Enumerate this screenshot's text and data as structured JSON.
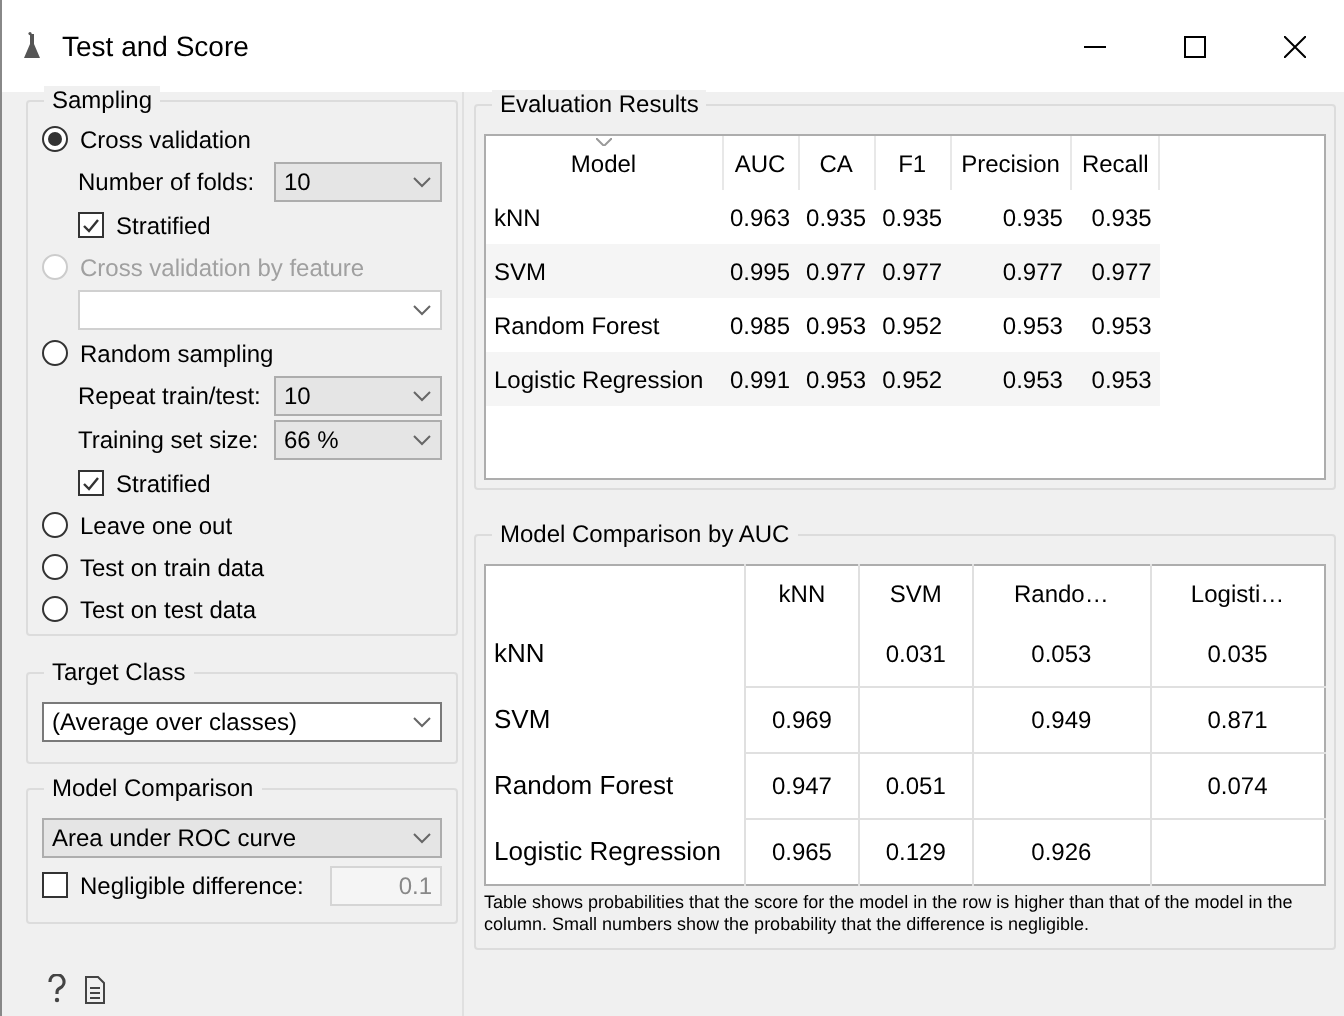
{
  "window": {
    "title": "Test and Score"
  },
  "sampling": {
    "title": "Sampling",
    "items": [
      {
        "kind": "radio",
        "label": "Cross validation",
        "selected": true,
        "disabled": false
      },
      {
        "kind": "combo",
        "label": "Number of folds:",
        "value": "10",
        "disabled": false
      },
      {
        "kind": "check",
        "label": "Stratified",
        "checked": true
      },
      {
        "kind": "radio",
        "label": "Cross validation by feature",
        "selected": false,
        "disabled": true
      },
      {
        "kind": "combo",
        "disabled": true
      },
      {
        "kind": "radio",
        "label": "Random sampling",
        "selected": false,
        "disabled": false
      },
      {
        "kind": "combo",
        "label": "Repeat train/test:",
        "value": "10",
        "disabled": false
      },
      {
        "kind": "combo",
        "label": "Training set size:",
        "value": "66 %",
        "disabled": false
      },
      {
        "kind": "check",
        "label": "Stratified",
        "checked": true
      },
      {
        "kind": "radio",
        "label": "Leave one out",
        "selected": false,
        "disabled": false
      },
      {
        "kind": "radio",
        "label": "Test on train data",
        "selected": false,
        "disabled": false
      },
      {
        "kind": "radio",
        "label": "Test on test data",
        "selected": false,
        "disabled": false
      }
    ]
  },
  "target_class": {
    "title": "Target Class",
    "value": "(Average over classes)"
  },
  "model_comparison": {
    "title": "Model Comparison",
    "value": "Area under ROC curve",
    "negligible": {
      "label": "Negligible difference:",
      "checked": false,
      "value": "0.1"
    }
  },
  "evaluation_results": {
    "title": "Evaluation Results",
    "columns": [
      "Model",
      "AUC",
      "CA",
      "F1",
      "Precision",
      "Recall"
    ],
    "rows": [
      [
        "kNN",
        "0.963",
        "0.935",
        "0.935",
        "0.935",
        "0.935"
      ],
      [
        "SVM",
        "0.995",
        "0.977",
        "0.977",
        "0.977",
        "0.977"
      ],
      [
        "Random Forest",
        "0.985",
        "0.953",
        "0.952",
        "0.953",
        "0.953"
      ],
      [
        "Logistic Regression",
        "0.991",
        "0.953",
        "0.952",
        "0.953",
        "0.953"
      ]
    ]
  },
  "comparison": {
    "title": "Model Comparison by AUC",
    "columns": [
      "kNN",
      "SVM",
      "Rando…",
      "Logisti…"
    ],
    "rows": [
      {
        "name": "kNN",
        "cells": [
          null,
          "0.031",
          "0.053",
          "0.035"
        ]
      },
      {
        "name": "SVM",
        "cells": [
          "0.969",
          null,
          "0.949",
          "0.871"
        ]
      },
      {
        "name": "Random Forest",
        "cells": [
          "0.947",
          "0.051",
          null,
          "0.074"
        ]
      },
      {
        "name": "Logistic Regression",
        "cells": [
          "0.965",
          "0.129",
          "0.926",
          null
        ]
      }
    ],
    "note": "Table shows probabilities that the score for the model in the row is higher than that of the model in the column. Small numbers show the probability that the difference is negligible."
  }
}
